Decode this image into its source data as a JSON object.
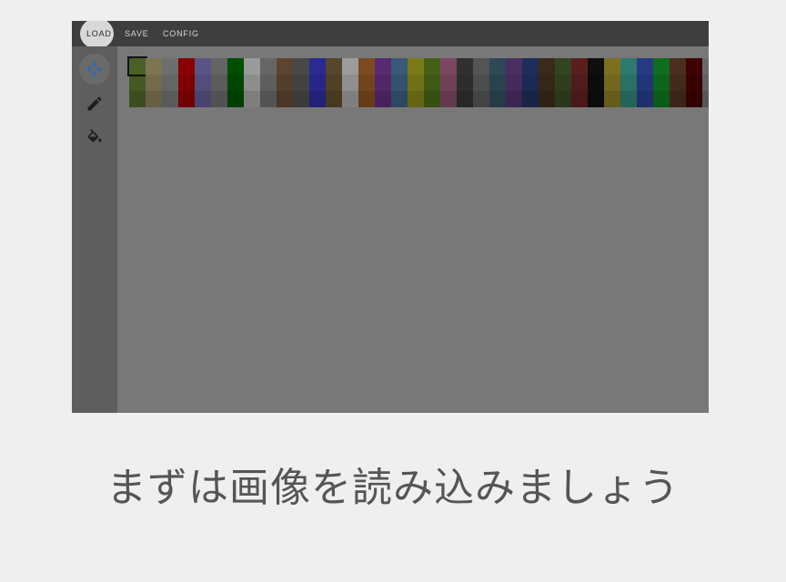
{
  "menu": {
    "load": "LOAD",
    "save": "SAVE",
    "config": "CONFIG"
  },
  "tools": [
    {
      "name": "move",
      "icon": "move-icon",
      "active": true
    },
    {
      "name": "pencil",
      "icon": "pencil-icon",
      "active": false
    },
    {
      "name": "fill",
      "icon": "paint-bucket-icon",
      "active": false
    }
  ],
  "palette": {
    "selected_index": 0,
    "colors": [
      "#4a6026",
      "#7e7452",
      "#6e6e6e",
      "#8a0000",
      "#5a5486",
      "#646464",
      "#004d00",
      "#9a9a9a",
      "#666666",
      "#5c4430",
      "#484848",
      "#2a2a92",
      "#56462a",
      "#9c9c9c",
      "#7c4a1e",
      "#5a2a72",
      "#3a5878",
      "#7c7a18",
      "#466018",
      "#7a4660",
      "#303030",
      "#545454",
      "#2e4856",
      "#4a2e62",
      "#1e2e5a",
      "#3a2a1a",
      "#324420",
      "#5a1e1e",
      "#0e0e0e",
      "#7c7020",
      "#2e7a6e",
      "#263a84",
      "#0e6e1e",
      "#4a2e1e",
      "#3e0000",
      "#6a6a6a"
    ]
  },
  "caption": "まずは画像を読み込みましょう"
}
